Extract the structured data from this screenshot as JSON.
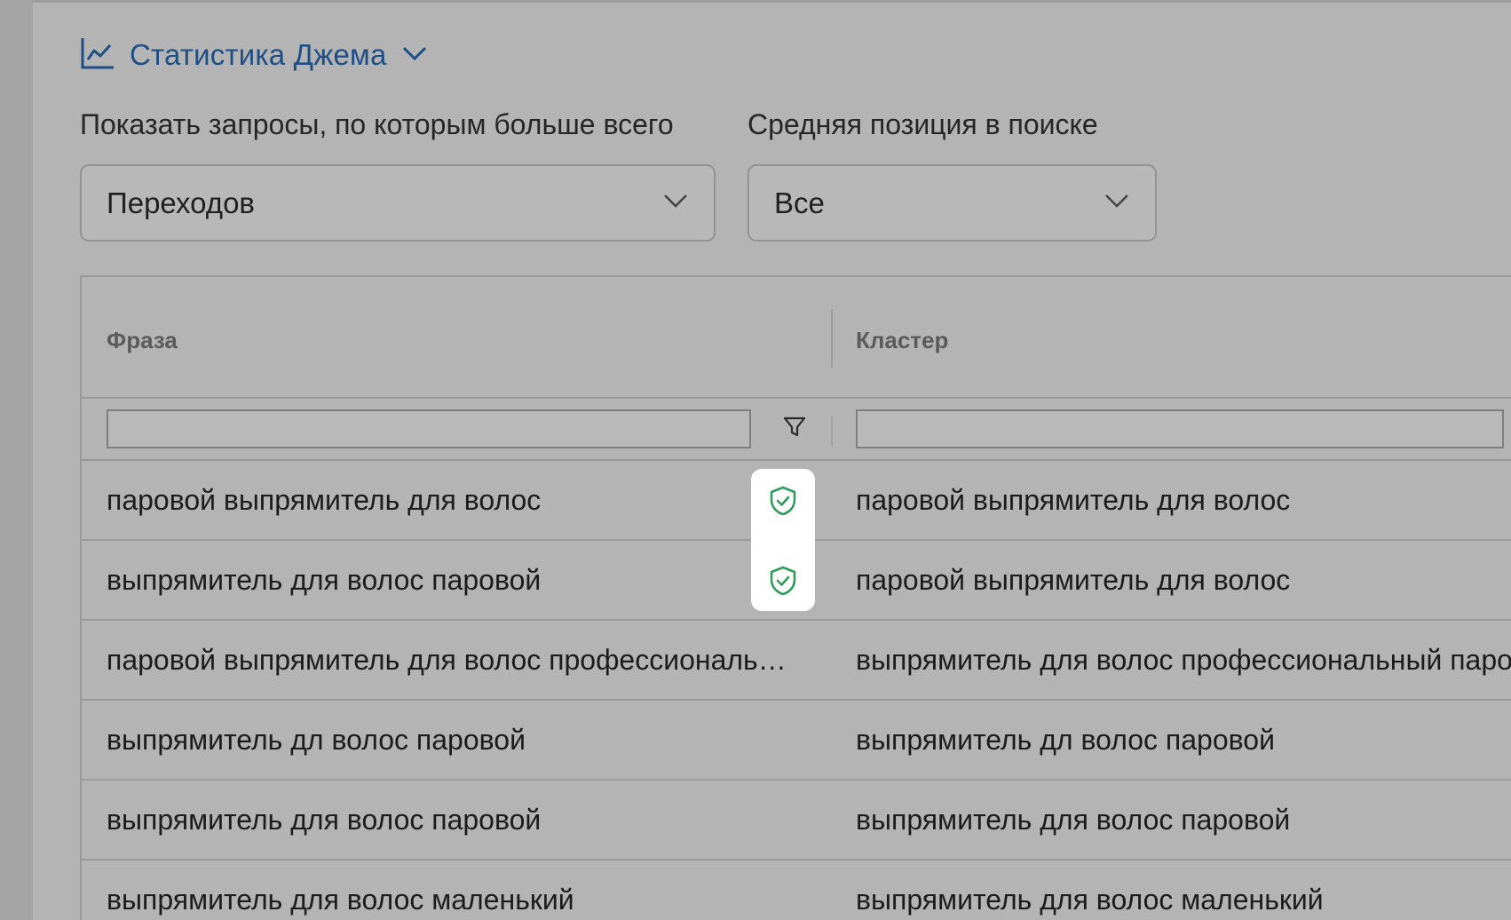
{
  "header": {
    "title": "Статистика Джема",
    "icon": "line-chart-icon",
    "accent_color": "#1d4f86"
  },
  "filters": {
    "top_by": {
      "label": "Показать запросы, по которым больше всего",
      "value": "Переходов"
    },
    "avg_position": {
      "label": "Средняя позиция в поиске",
      "value": "Все"
    }
  },
  "table": {
    "columns": [
      "Фраза",
      "Кластер"
    ],
    "phrase_filter": {
      "value": ""
    },
    "cluster_filter": {
      "value": ""
    },
    "rows": [
      {
        "phrase": "паровой выпрямитель для волос",
        "cluster": "паровой выпрямитель для волос",
        "verified": true
      },
      {
        "phrase": "выпрямитель для волос паровой",
        "cluster": "паровой выпрямитель для волос",
        "verified": true
      },
      {
        "phrase": "паровой выпрямитель для волос профессиональн...",
        "cluster": "выпрямитель для волос профессиональный паро",
        "verified": false
      },
      {
        "phrase": "выпрямитель дл волос паровой",
        "cluster": "выпрямитель дл волос паровой",
        "verified": false
      },
      {
        "phrase": "выпрямитель для волос паровой",
        "cluster": "выпрямитель для волос паровой",
        "verified": false
      },
      {
        "phrase": "выпрямитель для волос маленький",
        "cluster": "выпрямитель для волос маленький",
        "verified": false
      }
    ],
    "verified_color": "#2e9e5b"
  }
}
